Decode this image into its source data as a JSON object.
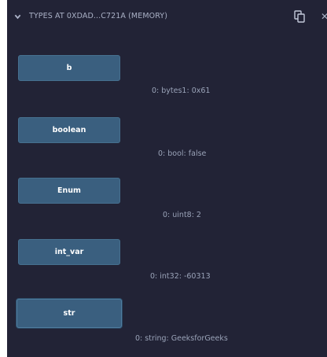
{
  "header": {
    "title": "TYPES AT 0XDAD...C721A (MEMORY)",
    "icons": [
      "chevron-down-icon",
      "copy-icon",
      "close-icon"
    ]
  },
  "items": [
    {
      "label": "b",
      "value": "0: bytes1: 0x61"
    },
    {
      "label": "boolean",
      "value": "0: bool: false"
    },
    {
      "label": "Enum",
      "value": "0: uint8: 2"
    },
    {
      "label": "int_var",
      "value": "0: int32: -60313"
    },
    {
      "label": "str",
      "value": "0: string: GeeksforGeeks"
    }
  ],
  "colors": {
    "panel_background": "#222336",
    "button_background": "#3a5f7f",
    "text_muted": "#9aa3b8"
  }
}
